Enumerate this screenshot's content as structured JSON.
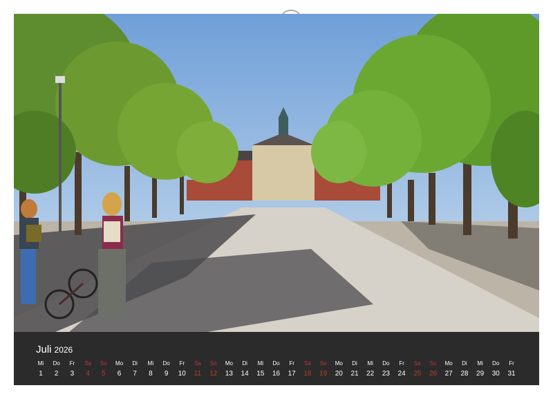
{
  "calendar": {
    "month": "Juli",
    "year": "2026",
    "weekend_color": "#c0392b",
    "days": [
      {
        "wd": "Mi",
        "n": "1",
        "we": false
      },
      {
        "wd": "Do",
        "n": "2",
        "we": false
      },
      {
        "wd": "Fr",
        "n": "3",
        "we": false
      },
      {
        "wd": "Sa",
        "n": "4",
        "we": true
      },
      {
        "wd": "So",
        "n": "5",
        "we": true
      },
      {
        "wd": "Mo",
        "n": "6",
        "we": false
      },
      {
        "wd": "Di",
        "n": "7",
        "we": false
      },
      {
        "wd": "Mi",
        "n": "8",
        "we": false
      },
      {
        "wd": "Do",
        "n": "9",
        "we": false
      },
      {
        "wd": "Fr",
        "n": "10",
        "we": false
      },
      {
        "wd": "Sa",
        "n": "11",
        "we": true
      },
      {
        "wd": "So",
        "n": "12",
        "we": true
      },
      {
        "wd": "Mo",
        "n": "13",
        "we": false
      },
      {
        "wd": "Di",
        "n": "14",
        "we": false
      },
      {
        "wd": "Mi",
        "n": "15",
        "we": false
      },
      {
        "wd": "Do",
        "n": "16",
        "we": false
      },
      {
        "wd": "Fr",
        "n": "17",
        "we": false
      },
      {
        "wd": "Sa",
        "n": "18",
        "we": true
      },
      {
        "wd": "So",
        "n": "19",
        "we": true
      },
      {
        "wd": "Mo",
        "n": "20",
        "we": false
      },
      {
        "wd": "Di",
        "n": "21",
        "we": false
      },
      {
        "wd": "Mi",
        "n": "22",
        "we": false
      },
      {
        "wd": "Do",
        "n": "23",
        "we": false
      },
      {
        "wd": "Fr",
        "n": "24",
        "we": false
      },
      {
        "wd": "Sa",
        "n": "25",
        "we": true
      },
      {
        "wd": "So",
        "n": "26",
        "we": true
      },
      {
        "wd": "Mo",
        "n": "27",
        "we": false
      },
      {
        "wd": "Di",
        "n": "28",
        "we": false
      },
      {
        "wd": "Mi",
        "n": "29",
        "we": false
      },
      {
        "wd": "Do",
        "n": "30",
        "we": false
      },
      {
        "wd": "Fr",
        "n": "31",
        "we": false
      }
    ]
  }
}
